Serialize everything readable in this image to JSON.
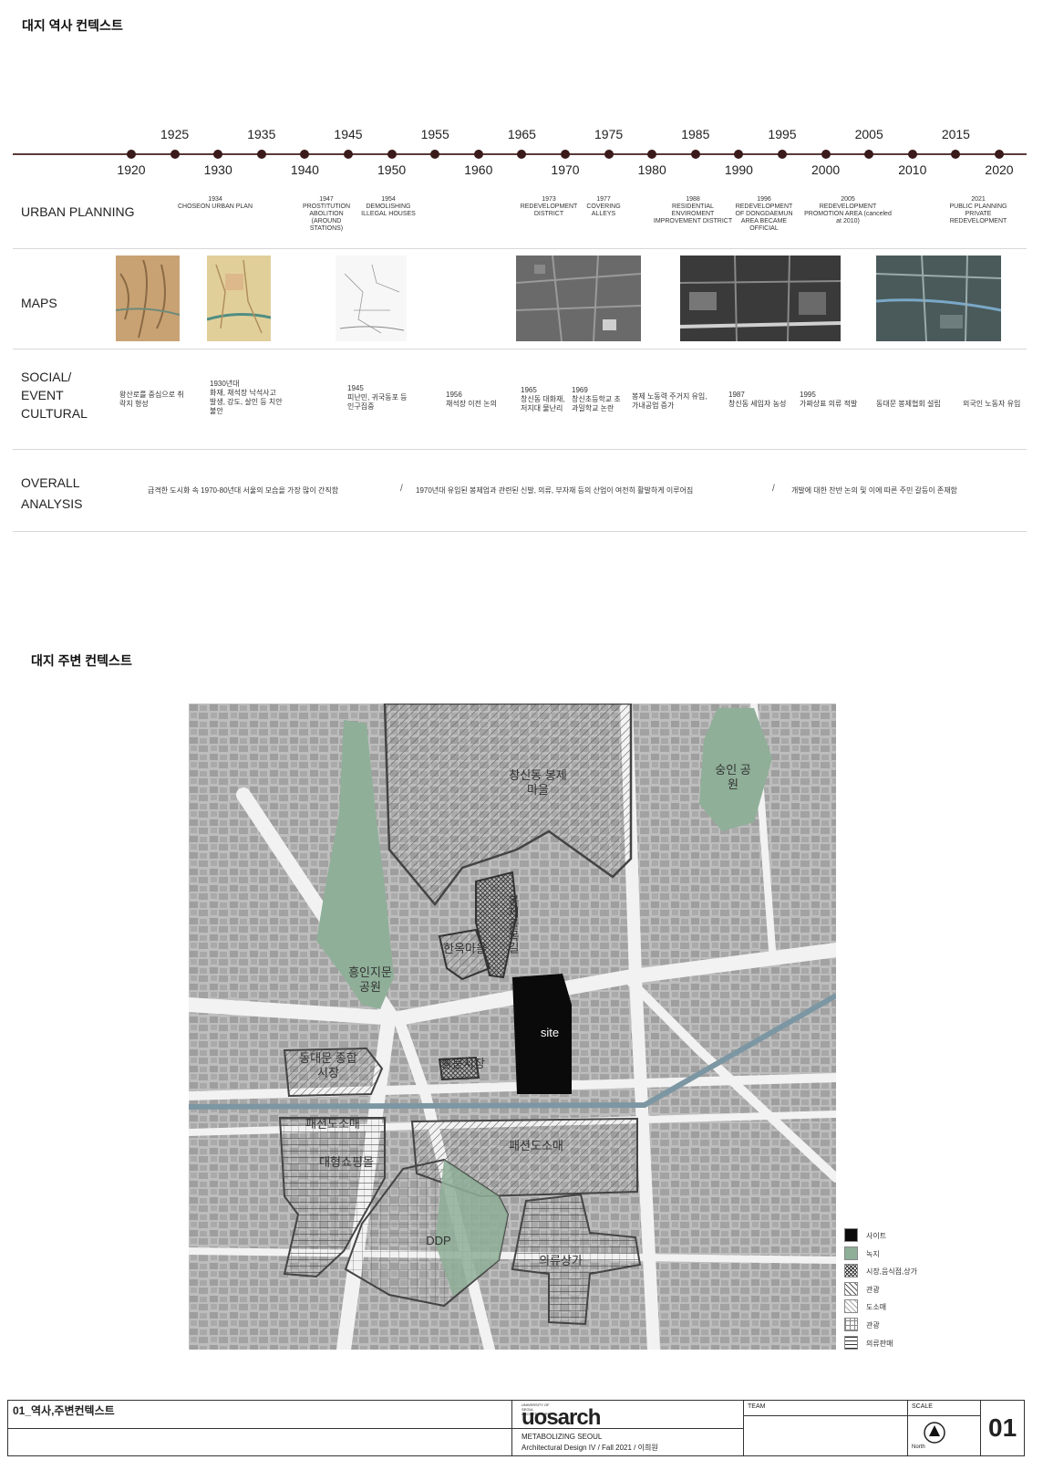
{
  "sections": {
    "history_title": "대지 역사 컨텍스트",
    "context_title": "대지 주변 컨텍스트"
  },
  "timeline": {
    "years_top": [
      "1925",
      "1935",
      "1945",
      "1955",
      "1965",
      "1975",
      "1985",
      "1995",
      "2005",
      "2015"
    ],
    "years_bottom": [
      "1920",
      "1930",
      "1940",
      "1950",
      "1960",
      "1970",
      "1980",
      "1990",
      "2000",
      "2010",
      "2020"
    ]
  },
  "rows": {
    "urban_planning": "URBAN PLANNING",
    "maps": "MAPS",
    "social_l1": "SOCIAL/",
    "social_l2": "EVENT",
    "social_l3": "CULTURAL",
    "overall_l1": "OVERALL",
    "overall_l2": "ANALYSIS"
  },
  "urban_events": [
    {
      "year": "1934",
      "text": "CHOSEON URBAN PLAN"
    },
    {
      "year": "1947",
      "text": "PROSTITUTION ABOLITION (AROUND STATIONS)"
    },
    {
      "year": "1954",
      "text": "DEMOLISHING ILLEGAL HOUSES"
    },
    {
      "year": "1973",
      "text": "REDEVELOPMENT DISTRICT"
    },
    {
      "year": "1977",
      "text": "COVERING ALLEYS"
    },
    {
      "year": "1988",
      "text": "RESIDENTIAL ENVIROMENT IMPROVEMENT DISTRICT"
    },
    {
      "year": "1996",
      "text": "REDEVELOPMENT OF DONGDAEMUN AREA BECAME OFFICIAL"
    },
    {
      "year": "2005",
      "text": "REDEVELOPMENT PROMOTION AREA (canceled at 2010)"
    },
    {
      "year": "2021",
      "text": "PUBLIC PLANNING PRIVATE REDEVELOPMENT"
    }
  ],
  "social_events": [
    {
      "year": "",
      "text": "왕산로를 중심으로 취락지 형성"
    },
    {
      "year": "1930년대",
      "text": "화재, 채석장 낙석사고 발생, 강도, 살인 등 치안 불안"
    },
    {
      "year": "1945",
      "text": "피난민, 귀국동포 등 인구집중"
    },
    {
      "year": "1956",
      "text": "채석장 이전 논의"
    },
    {
      "year": "1965",
      "text": "창신동 대화재, 저지대 물난리"
    },
    {
      "year": "1969",
      "text": "창신초등학교 초과밀학교 논란"
    },
    {
      "year": "",
      "text": "봉제 노동력 주거지 유입, 가내공업 증가"
    },
    {
      "year": "1987",
      "text": "창신동 세입자 농성"
    },
    {
      "year": "1995",
      "text": "가짜상표 의류 적발"
    },
    {
      "year": "",
      "text": "동대문 봉제협회 설립"
    },
    {
      "year": "",
      "text": "외국인 노동자 유입"
    }
  ],
  "analysis": [
    "급격한 도시화 속 1970-80년대 서울의 모습을 가장 많이 간직함",
    "1970년대 유입된 봉제업과 관련된 신발, 의류, 부자재 등의 산업이 여전히 활발하게 이루어짐",
    "개발에 대한 찬반 논의 및 이에 따른 주민 갈등이 존재함"
  ],
  "map_labels": {
    "changsin": "창신동 봉제마을",
    "sungin": "숭인 공원",
    "heungin": "흥인지문 공원",
    "hanok": "한옥마을",
    "alley": "봉제골목길",
    "site": "site",
    "dongdaemun_market": "동대문 종합시장",
    "tonglip": "통문시장",
    "fashion_retail_1": "패션도소매",
    "mall": "대형쇼핑몰",
    "fashion_retail_2": "패션도소매",
    "ddp": "DDP",
    "clothing": "의류상가"
  },
  "legend": [
    {
      "label": "사이트",
      "pattern": "solid-black"
    },
    {
      "label": "녹지",
      "pattern": "solid-green"
    },
    {
      "label": "시장,음식점,상가",
      "pattern": "crosshatch-dense"
    },
    {
      "label": "관광",
      "pattern": "diagonal"
    },
    {
      "label": "도소매",
      "pattern": "diagonal-light"
    },
    {
      "label": "관광",
      "pattern": "grid"
    },
    {
      "label": "의류판매",
      "pattern": "horizontal"
    }
  ],
  "colors": {
    "timeline": "#5a3a3a",
    "green": "#8faf98",
    "site": "#0a0a0a",
    "river": "#7c97a3"
  },
  "footer": {
    "sheet_title": "01_역사,주변컨텍스트",
    "school_small": "UNIVERSITY OF SEOUL ARCHITECTURE",
    "logo": "uosarch",
    "project": "METABOLIZING SEOUL",
    "course": "Architectural Design IV / Fall 2021 / 이희원",
    "team_label": "TEAM",
    "scale_label": "SCALE",
    "north_label": "North",
    "sheet_no": "01"
  }
}
